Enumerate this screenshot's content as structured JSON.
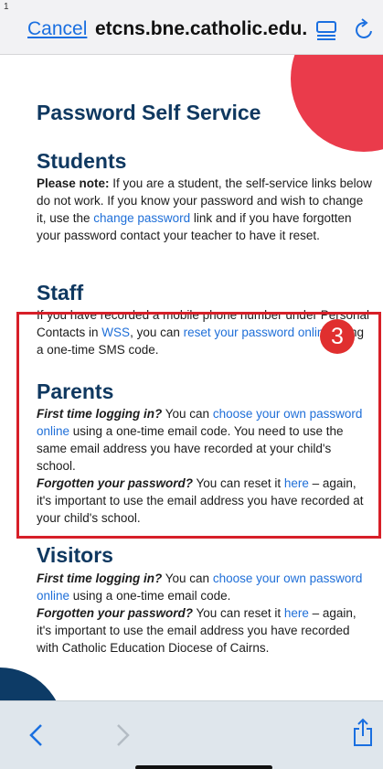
{
  "browser": {
    "cancel_label": "Cancel",
    "url": "etcns.bne.catholic.edu.au",
    "corner_mark": "1"
  },
  "page": {
    "title": "Password Self Service",
    "students": {
      "heading": "Students",
      "note_label": "Please note:",
      "text_1": " If you are a student, the self-service links below do not work. If you know your password and wish to change it, use the ",
      "link_change": "change password",
      "text_2": " link and if you have forgotten your password contact your teacher to have it reset."
    },
    "staff": {
      "heading": "Staff",
      "text_1": "If you have recorded a mobile phone number under Personal Contacts in ",
      "link_wss": "WSS",
      "text_2": ", you can ",
      "link_reset": "reset your password online",
      "text_3": " using a one-time SMS code."
    },
    "parents": {
      "heading": "Parents",
      "first_label": "First time logging in?",
      "first_text_1": " You can ",
      "first_link": "choose your own password online",
      "first_text_2": " using a one-time email code. You need to use the same email address you have recorded at your child's school.",
      "forgot_label": "Forgotten your password?",
      "forgot_text_1": " You can reset it ",
      "forgot_link": "here",
      "forgot_text_2": " – again, it's important to use the email address you have recorded at your child's school."
    },
    "visitors": {
      "heading": "Visitors",
      "first_label": "First time logging in?",
      "first_text_1": " You can ",
      "first_link": "choose your own password online",
      "first_text_2": " using a one-time email code.",
      "forgot_label": "Forgotten your password?",
      "forgot_text_1": " You can reset it ",
      "forgot_link": "here",
      "forgot_text_2": " – again, it's important to use the email address you have recorded with Catholic Education Diocese of Cairns."
    }
  },
  "annotation": {
    "badge_number": "3",
    "box_color": "#d71f28"
  },
  "icons": {
    "reader": "reader-mode-icon",
    "reload": "reload-icon",
    "back": "chevron-left-icon",
    "forward": "chevron-right-icon",
    "share": "share-icon"
  },
  "colors": {
    "heading": "#0f3860",
    "link": "#1f6fd8",
    "accent_red": "#ea3b4b",
    "accent_navy": "#0d3b66"
  }
}
